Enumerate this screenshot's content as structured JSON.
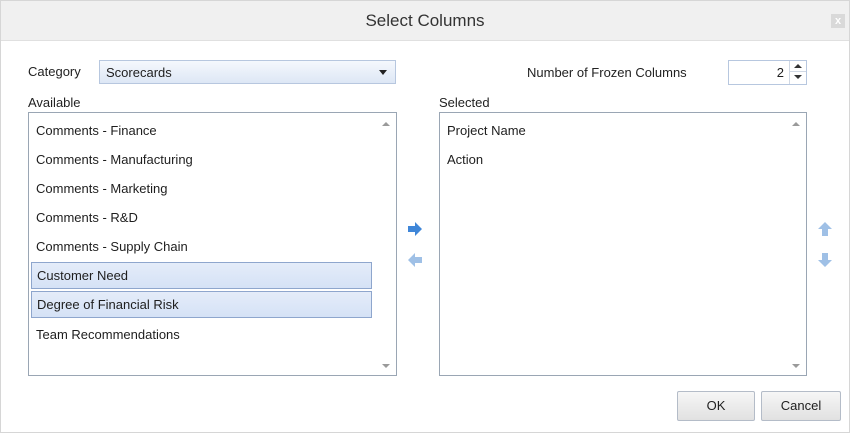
{
  "dialog": {
    "title": "Select Columns",
    "close_label": "x"
  },
  "category": {
    "label": "Category",
    "selected": "Scorecards"
  },
  "frozen": {
    "label": "Number of Frozen Columns",
    "value": "2"
  },
  "available": {
    "label": "Available",
    "items": [
      "Comments - Finance",
      "Comments - Manufacturing",
      "Comments - Marketing",
      "Comments - R&D",
      "Comments - Supply Chain",
      "Customer Need",
      "Degree of Financial Risk",
      "Team Recommendations"
    ],
    "selected_items": [
      "Customer Need",
      "Degree of Financial Risk"
    ]
  },
  "selected": {
    "label": "Selected",
    "items": [
      "Project Name",
      "Action"
    ]
  },
  "icons": {
    "add": "arrow-right-icon",
    "remove": "arrow-left-icon",
    "move_up": "arrow-up-icon",
    "move_down": "arrow-down-icon"
  },
  "colors": {
    "accent_arrow": "#3f86d8",
    "faded_arrow": "#9fc0e6",
    "selection_border": "#8ea6cd"
  },
  "buttons": {
    "ok": "OK",
    "cancel": "Cancel"
  }
}
